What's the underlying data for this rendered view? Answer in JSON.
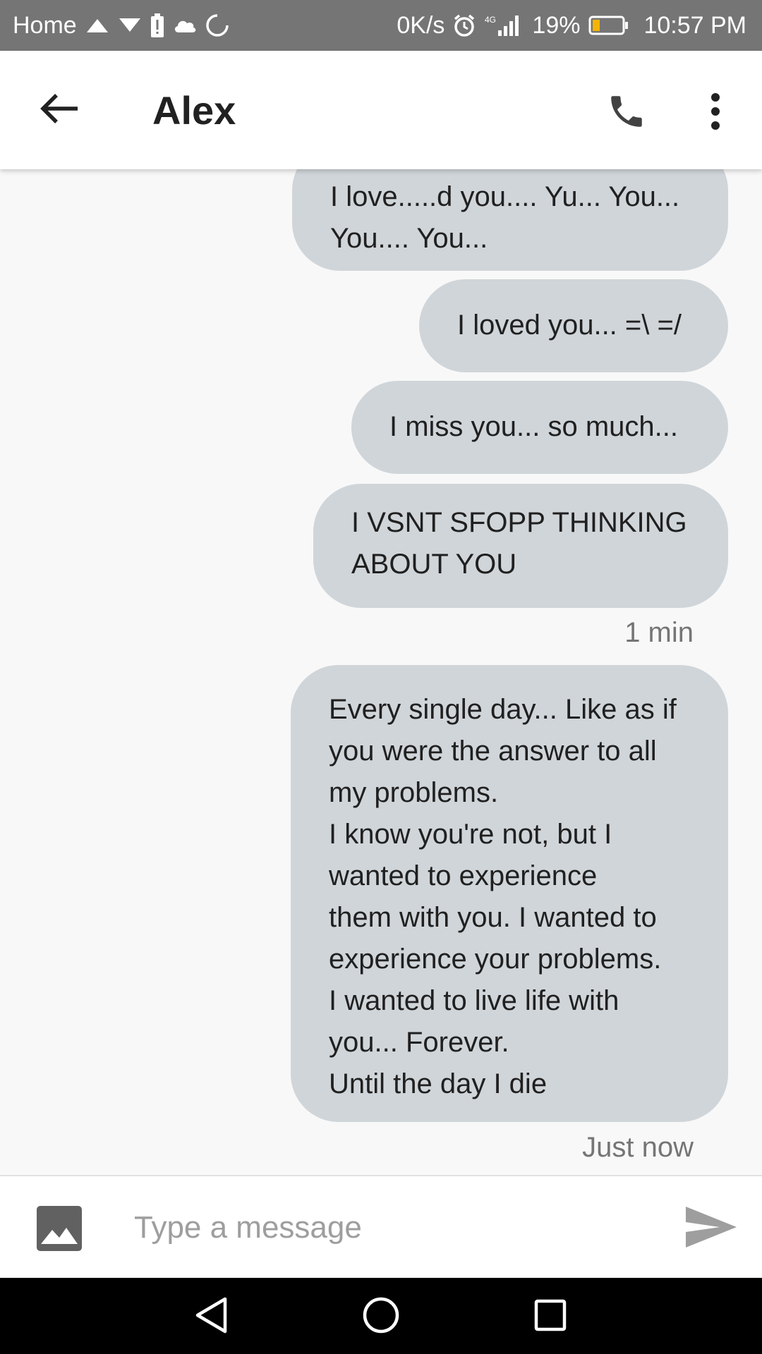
{
  "status_bar": {
    "carrier": "Home",
    "network_speed": "0K/s",
    "network_type": "4G",
    "battery_percent": "19%",
    "time": "10:57 PM"
  },
  "header": {
    "contact_name": "Alex"
  },
  "messages": [
    {
      "text": "I love.....d you.... Yu... You...\nYou.... You..."
    },
    {
      "text": "I loved you... =\\ =/"
    },
    {
      "text": "I miss you... so much..."
    },
    {
      "text": "I VSNT SFOPP THINKING\nABOUT YOU"
    },
    {
      "text": "Every single day... Like as if\nyou were the answer to all\nmy problems.\nI know you're not, but I\nwanted to experience\nthem with you. I wanted to\nexperience your problems.\nI wanted to live life with\nyou... Forever.\nUntil the day I die"
    }
  ],
  "timestamps": [
    "1 min",
    "Just now"
  ],
  "compose": {
    "placeholder": "Type a message"
  },
  "colors": {
    "status_bar": "#757575",
    "app_bar": "#ffffff",
    "bubble": "#d0d5d9",
    "background": "#f8f8f8",
    "nav_bar": "#000000"
  },
  "icons": {
    "status": [
      "upload-icon",
      "download-icon",
      "battery-alert-icon",
      "cloud-icon",
      "sync-icon",
      "alarm-icon",
      "signal-icon",
      "battery-icon"
    ],
    "header": [
      "arrow-back-icon",
      "phone-icon",
      "more-vert-icon"
    ],
    "compose": [
      "image-icon",
      "send-icon"
    ],
    "navigation": [
      "nav-back-icon",
      "nav-home-icon",
      "nav-recents-icon"
    ]
  }
}
